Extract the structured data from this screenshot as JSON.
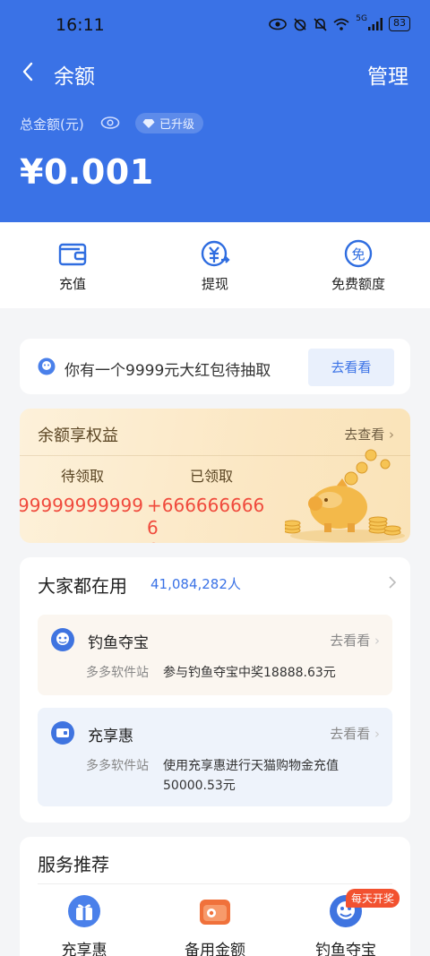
{
  "status_bar": {
    "time": "16:11",
    "signal_label": "5G",
    "battery": "83"
  },
  "header": {
    "title": "余额",
    "manage_label": "管理",
    "total_label": "总金额(元)",
    "upgrade_badge": "已升级",
    "balance": "¥0.001"
  },
  "actions": [
    {
      "label": "充值",
      "icon": "wallet-icon"
    },
    {
      "label": "提现",
      "icon": "withdraw-icon"
    },
    {
      "label": "免费额度",
      "icon": "free-icon"
    }
  ],
  "promo": {
    "text": "你有一个9999元大红包待抽取",
    "button": "去看看"
  },
  "benefit": {
    "title": "余额享权益",
    "link": "去查看",
    "pending_label": "待领取",
    "received_label": "已领取",
    "pending_value": "99999999999",
    "received_value": "+6666666666",
    "received_value_tail": "6"
  },
  "popular": {
    "title": "大家都在用",
    "count": "41,084,282人",
    "items": [
      {
        "name": "钓鱼夺宝",
        "link": "去看看",
        "source": "多多软件站",
        "desc": "参与钓鱼夺宝中奖18888.63元"
      },
      {
        "name": "充享惠",
        "link": "去看看",
        "source": "多多软件站",
        "desc": "使用充享惠进行天猫购物金充值50000.53元"
      }
    ]
  },
  "services": {
    "title": "服务推荐",
    "items": [
      {
        "label": "充享惠"
      },
      {
        "label": "备用金额"
      },
      {
        "label": "钓鱼夺宝"
      }
    ],
    "tag": "每天开奖"
  },
  "colors": {
    "brand": "#3a72e6",
    "price_red": "#f04a3c",
    "tag_orange": "#f2512f"
  }
}
